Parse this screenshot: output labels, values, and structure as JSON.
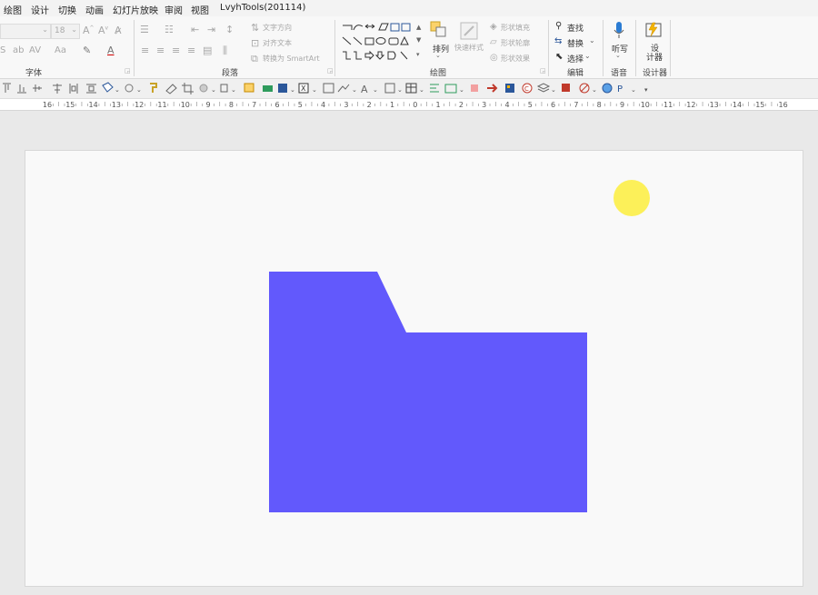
{
  "menu": {
    "tabs": [
      "绘图",
      "设计",
      "切换",
      "动画",
      "幻灯片放映",
      "审阅",
      "视图",
      "LvyhTools(201114)"
    ]
  },
  "ribbon": {
    "font": {
      "font_size": "18",
      "group_label": "字体"
    },
    "paragraph": {
      "text_direction": "文字方向",
      "align_text": "对齐文本",
      "convert_smartart": "转换为 SmartArt",
      "group_label": "段落"
    },
    "drawing": {
      "arrange": "排列",
      "quick_styles": "快速样式",
      "shape_fill": "形状填充",
      "shape_outline": "形状轮廓",
      "shape_effects": "形状效果",
      "group_label": "绘图"
    },
    "editing": {
      "find": "查找",
      "replace": "替换",
      "select": "选择",
      "group_label": "编辑"
    },
    "voice": {
      "dictate": "听写",
      "group_label": "语音"
    },
    "designer": {
      "designer_btn_line1": "设",
      "designer_btn_line2": "计器",
      "group_label": "设计器"
    }
  },
  "ruler": {
    "labels": [
      "16",
      "15",
      "14",
      "13",
      "12",
      "11",
      "10",
      "9",
      "8",
      "7",
      "6",
      "5",
      "4",
      "3",
      "2",
      "1",
      "0",
      "1",
      "2",
      "3",
      "4",
      "5",
      "6",
      "7",
      "8",
      "9",
      "10",
      "11",
      "12",
      "13",
      "14",
      "15",
      "16"
    ]
  },
  "colors": {
    "folder_fill": "#6259fc",
    "circle_fill": "#fcf059",
    "accent_blue": "#2b579a",
    "ime_orange": "#f06a35",
    "ime_blue": "#1a73e8"
  },
  "icons": {
    "ime": [
      "sogou-s-icon",
      "chinese-mode-icon",
      "punctuation-icon",
      "microphone-icon",
      "keyboard-icon",
      "shirt-icon",
      "grid-icon"
    ]
  }
}
